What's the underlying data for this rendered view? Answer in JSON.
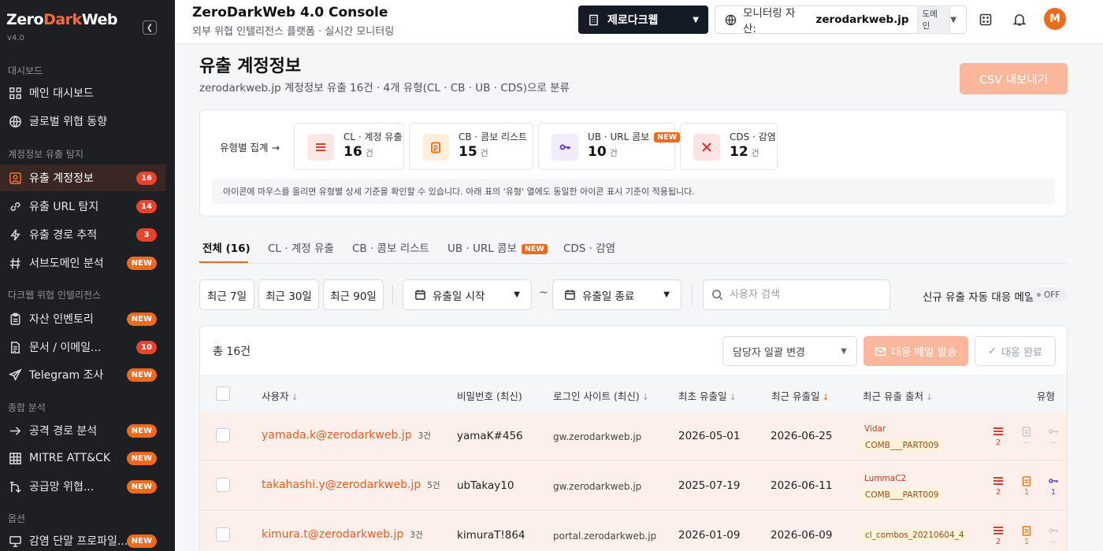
{
  "brand": {
    "name_part1": "Zero",
    "name_part2": "Dark",
    "name_part3": "Web",
    "version": "v4.0"
  },
  "sidebar": {
    "sections": [
      "대시보드",
      "계정정보 유출 탐지",
      "다크웹 위협 인텔리전스",
      "종합 분석",
      "옵션"
    ],
    "items": [
      {
        "label": "메인 대시보드",
        "icon": "grid-icon",
        "badge": ""
      },
      {
        "label": "글로벌 위협 동향",
        "icon": "globe-icon",
        "badge": ""
      },
      {
        "label": "유출 계정정보",
        "icon": "user-icon",
        "badge": "16",
        "active": true
      },
      {
        "label": "유출 URL 탐지",
        "icon": "link-icon",
        "badge": "14"
      },
      {
        "label": "유출 경로 추적",
        "icon": "bolt-icon",
        "badge": "3"
      },
      {
        "label": "서브도메인 분석",
        "icon": "hash-icon",
        "badge": "NEW"
      },
      {
        "label": "자산 인벤토리",
        "icon": "clipboard-icon",
        "badge": "NEW"
      },
      {
        "label": "문서 / 이메일...",
        "icon": "document-icon",
        "badge": "10"
      },
      {
        "label": "Telegram 조사",
        "icon": "send-icon",
        "badge": "NEW"
      },
      {
        "label": "공격 경로 분석",
        "icon": "arrow-right-icon",
        "badge": "NEW"
      },
      {
        "label": "MITRE ATT&CK",
        "icon": "table-icon",
        "badge": "NEW"
      },
      {
        "label": "공급망 위협...",
        "icon": "branch-icon",
        "badge": "NEW"
      },
      {
        "label": "감염 단말 프로파일...",
        "icon": "device-icon",
        "badge": "NEW"
      }
    ]
  },
  "topbar": {
    "title": "ZeroDarkWeb 4.0 Console",
    "subtitle": "외부 위협 인텔리전스 플랫폼 · 실시간 모니터링",
    "org": "제로다크웹",
    "asset_label": "모니터링 자산:",
    "asset_value": "zerodarkweb.jp",
    "asset_tag": "도메인",
    "avatar": "M"
  },
  "page": {
    "title": "유출 계정정보",
    "subtitle": "zerodarkweb.jp 계정정보 유출 16건 · 4개 유형(CL · CB · UB · CDS)으로 분류",
    "csv": "CSV 내보내기"
  },
  "summary": {
    "label": "유형별 집계 →",
    "hint": "아이콘에 마우스를 올리면 유형별 상세 기준을 확인할 수 있습니다. 아래 표의 '유형' 열에도 동일한 아이콘 표시 기준이 적용됩니다.",
    "unit": "건",
    "new": "NEW",
    "stats": [
      {
        "name": "CL · 계정 유출",
        "value": "16"
      },
      {
        "name": "CB · 콤보 리스트",
        "value": "15"
      },
      {
        "name": "UB · URL 콤보",
        "value": "10"
      },
      {
        "name": "CDS · 감염",
        "value": "12"
      }
    ]
  },
  "tabs": [
    "전체 (16)",
    "CL · 계정 유출",
    "CB · 콤보 리스트",
    "UB · URL 콤보",
    "CDS · 감염"
  ],
  "tabs_new": "NEW",
  "filters": {
    "ranges": [
      "최근 7일",
      "최근 30일",
      "최근 90일"
    ],
    "start": "유출일 시작",
    "end": "유출일 종료",
    "tilde": "~",
    "search_placeholder": "사용자 검색",
    "auto_mail": "신규 유출 자동 대응 메일",
    "toggle": "OFF"
  },
  "table": {
    "total": "총 16건",
    "assign": "담당자 일괄 변경",
    "mail": "대응 메일 발송",
    "done": "대응 완료",
    "columns": [
      "사용자",
      "비밀번호 (최신)",
      "로그인 사이트 (최신)",
      "최초 유출일",
      "최근 유출일",
      "최근 유출 출처",
      "유형"
    ],
    "rows": [
      {
        "email": "yamada.k@zerodarkweb.jp",
        "count": "3건",
        "password": "yamaK#456",
        "site": "gw.zerodarkweb.jp",
        "first": "2026-05-01",
        "last": "2026-06-25",
        "src1": "Vidar",
        "src2": "COMB___PART009",
        "t1": "2",
        "t2": "—",
        "t3": "—"
      },
      {
        "email": "takahashi.y@zerodarkweb.jp",
        "count": "5건",
        "password": "ubTakay10",
        "site": "gw.zerodarkweb.jp",
        "first": "2025-07-19",
        "last": "2026-06-11",
        "src1": "LummaC2",
        "src2": "COMB___PART009",
        "t1": "2",
        "t2": "1",
        "t3": "1"
      },
      {
        "email": "kimura.t@zerodarkweb.jp",
        "count": "3건",
        "password": "kimuraT!864",
        "site": "portal.zerodarkweb.jp",
        "first": "2026-01-09",
        "last": "2026-06-09",
        "src1": "",
        "src2": "cl_combos_20210604_4",
        "t1": "2",
        "t2": "1",
        "t3": "—"
      }
    ]
  }
}
